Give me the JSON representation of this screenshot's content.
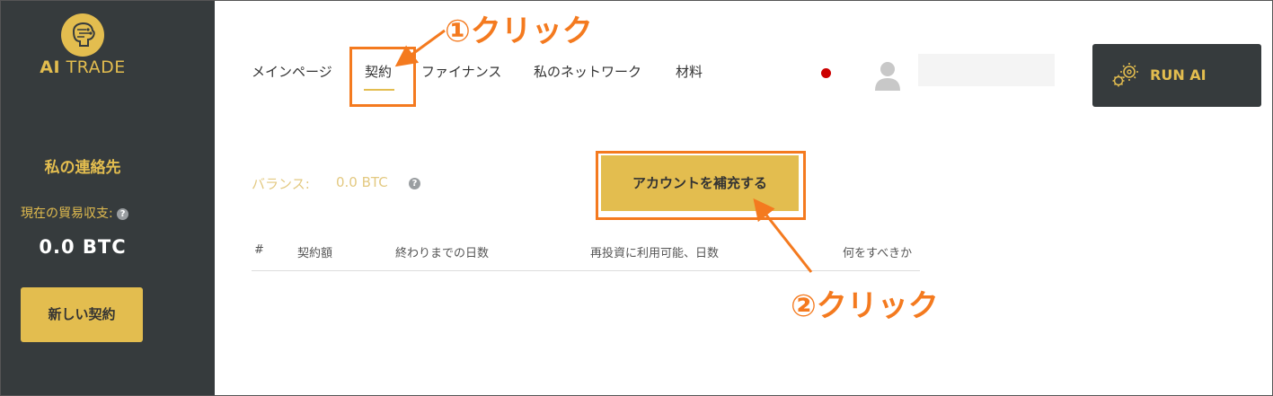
{
  "sidebar": {
    "logo_text_bold": "AI",
    "logo_text": " TRADE",
    "title": "私の連絡先",
    "balance_label": "現在の貿易収支:",
    "help": "?",
    "balance_value": "0.0 BTC",
    "new_contract_label": "新しい契約"
  },
  "nav": {
    "items": [
      {
        "label": "メインページ"
      },
      {
        "label": "契約"
      },
      {
        "label": "ファイナンス"
      },
      {
        "label": "私のネットワーク"
      },
      {
        "label": "材料"
      }
    ]
  },
  "header": {
    "run_label": "RUN AI"
  },
  "main": {
    "balance_label": "バランス:",
    "balance_value": "0.0 BTC",
    "help": "?",
    "topup_label": "アカウントを補充する",
    "table_headers": [
      "#",
      "契約額",
      "終わりまでの日数",
      "再投資に利用可能、日数",
      "何をすべきか"
    ]
  },
  "annotations": {
    "step1": "①クリック",
    "step2": "②クリック"
  },
  "colors": {
    "accent": "#e3bd4f",
    "sidebar_bg": "#363b3d",
    "annotation": "#f47a1f",
    "status_dot": "#cc0000"
  }
}
